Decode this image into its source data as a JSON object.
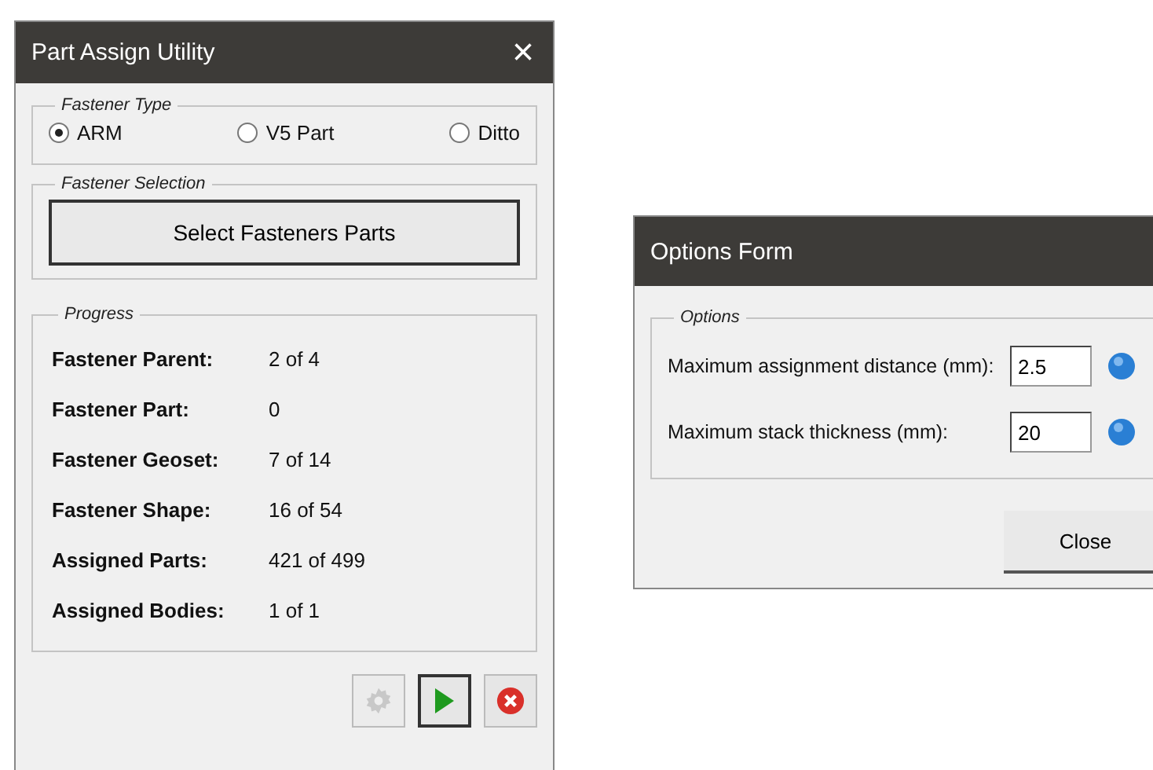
{
  "windows": [
    {
      "title": "Part Assign Utility",
      "close": "×",
      "fastener_type": {
        "legend": "Fastener Type",
        "options": [
          {
            "label": "ARM",
            "selected": true
          },
          {
            "label": "V5 Part",
            "selected": false
          },
          {
            "label": "Ditto",
            "selected": false
          }
        ]
      },
      "fastener_selection": {
        "legend": "Fastener Selection",
        "button": "Select Fasteners Parts"
      },
      "progress": {
        "legend": "Progress",
        "rows": [
          {
            "label": "Fastener Parent:",
            "value": "2 of 4"
          },
          {
            "label": "Fastener Part:",
            "value": "0"
          },
          {
            "label": "Fastener Geoset:",
            "value": "7 of 14"
          },
          {
            "label": "Fastener Shape:",
            "value": "16 of 54"
          },
          {
            "label": "Assigned Parts:",
            "value": "421 of 499"
          },
          {
            "label": "Assigned Bodies:",
            "value": "1 of 1"
          }
        ]
      },
      "toolbar": [
        {
          "kind": "settings",
          "disabled": true
        },
        {
          "kind": "run",
          "disabled": false
        },
        {
          "kind": "cancel",
          "disabled": false
        }
      ]
    },
    {
      "title": "Options Form",
      "options": {
        "legend": "Options",
        "fields": [
          {
            "label": "Maximum assignment distance (mm):",
            "value": "2.5"
          },
          {
            "label": "Maximum stack thickness (mm):",
            "value": "20"
          }
        ]
      },
      "button": "Close"
    }
  ]
}
